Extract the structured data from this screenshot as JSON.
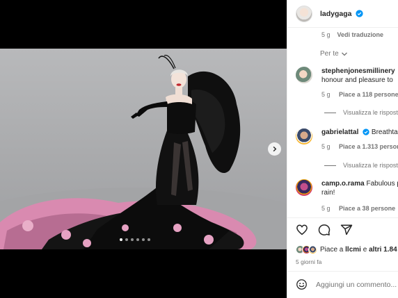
{
  "post": {
    "username": "ladygaga",
    "caption_meta": {
      "time": "5 g",
      "translate": "Vedi traduzione"
    },
    "carousel": {
      "slide_count": 6,
      "active_slide": 1
    },
    "sort_label": "Per te"
  },
  "comments": [
    {
      "username": "stephenjonesmillinery",
      "text": "",
      "line2": "honour and pleasure to",
      "time": "5 g",
      "likes": "Piace a 118 persone",
      "replies_label": "Visualizza le rispost"
    },
    {
      "username": "gabrielattal",
      "text": "Breathtak",
      "line2": "",
      "time": "5 g",
      "likes": "Piace a 1.313 persone",
      "replies_label": "Visualizza le rispost"
    },
    {
      "username": "camp.o.rama",
      "text": "Fabulous p",
      "line2": "rain!",
      "time": "5 g",
      "likes": "Piace a 38 persone",
      "replies_label": ""
    }
  ],
  "engagement": {
    "likes_prefix": "Piace a",
    "likes_user": "llcmi",
    "likes_conj": "e",
    "likes_others": "altri 1.84",
    "date": "5 giorni fa"
  },
  "composer": {
    "placeholder": "Aggiungi un commento..."
  },
  "icons": [
    "verified-badge-icon",
    "chevron-down-icon",
    "chevron-right-icon",
    "heart-icon",
    "comment-icon",
    "share-icon",
    "emoji-icon"
  ],
  "colors": {
    "verified": "#0095f6",
    "text": "#262626",
    "muted": "#737373",
    "divider": "#efefef"
  }
}
